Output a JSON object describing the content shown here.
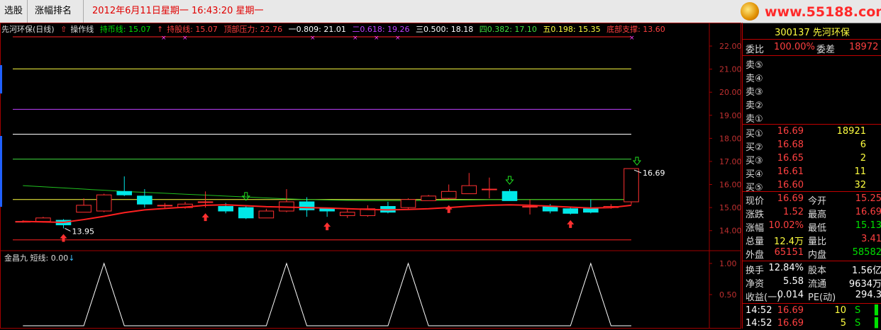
{
  "toolbar": {
    "tab_select": "选股",
    "tab_rank": "涨幅排名",
    "datetime": "2012年6月11日星期一  16:43:20 星期一",
    "logo": "www.55188.com"
  },
  "chart_legend": {
    "name": "先河环保(日线)",
    "op_line": "操作线",
    "hold_coin": "持币线: 15.07",
    "hold_stock": "持股线: 15.07",
    "top_pressure": "顶部压力: 22.76",
    "fib1": "一0.809: 21.01",
    "fib2": "二0.618: 19.26",
    "fib3": "三0.500: 18.18",
    "fib4": "四0.382: 17.10",
    "fib5": "五0.198: 15.35",
    "bottom_support": "底部支撑: 13.60",
    "colors": {
      "hold_coin": "#00e000",
      "hold_stock": "#ff4040",
      "fib2": "#c040ff",
      "fib4": "#40e040",
      "fib5": "#ffff40"
    }
  },
  "sub_indicator": {
    "name": "金昌九",
    "short_line": "短线: 0.00"
  },
  "quote": {
    "code": "300137",
    "name": "先河环保",
    "weibi_label": "委比",
    "weibi": "100.00%",
    "weicha_label": "委差",
    "weicha": "18972",
    "sell_labels": [
      "卖⑤",
      "卖④",
      "卖③",
      "卖②",
      "卖①"
    ],
    "buy": [
      {
        "label": "买①",
        "price": "16.69",
        "vol": "18921"
      },
      {
        "label": "买②",
        "price": "16.68",
        "vol": "6"
      },
      {
        "label": "买③",
        "price": "16.65",
        "vol": "2"
      },
      {
        "label": "买④",
        "price": "16.61",
        "vol": "11"
      },
      {
        "label": "买⑤",
        "price": "16.60",
        "vol": "32"
      }
    ],
    "stats": [
      {
        "l1": "现价",
        "v1": "16.69",
        "l2": "今开",
        "v2": "15.25",
        "c1": "#ff4040",
        "c2": "#ff4040"
      },
      {
        "l1": "涨跌",
        "v1": "1.52",
        "l2": "最高",
        "v2": "16.69",
        "c1": "#ff4040",
        "c2": "#ff4040"
      },
      {
        "l1": "涨幅",
        "v1": "10.02%",
        "l2": "最低",
        "v2": "15.13",
        "c1": "#ff4040",
        "c2": "#00e000"
      },
      {
        "l1": "总量",
        "v1": "12.4万",
        "l2": "量比",
        "v2": "3.41",
        "c1": "#ffff40",
        "c2": "#ff4040"
      },
      {
        "l1": "外盘",
        "v1": "65151",
        "l2": "内盘",
        "v2": "58582",
        "c1": "#ff4040",
        "c2": "#00e000"
      }
    ],
    "stats2": [
      {
        "l1": "换手",
        "v1": "12.84%",
        "l2": "股本",
        "v2": "1.56亿"
      },
      {
        "l1": "净资",
        "v1": "5.58",
        "l2": "流通",
        "v2": "9634万"
      },
      {
        "l1": "收益(一)",
        "v1": "0.014",
        "l2": "PE(动)",
        "v2": "294.3"
      }
    ],
    "ticks": [
      {
        "time": "14:52",
        "price": "16.69",
        "vol": "10",
        "side": "S"
      },
      {
        "time": "14:52",
        "price": "16.69",
        "vol": "5",
        "side": "S"
      }
    ]
  },
  "chart_data": {
    "type": "candlestick",
    "y_ticks": [
      "22.00",
      "21.00",
      "20.00",
      "19.00",
      "18.00",
      "17.00",
      "16.00",
      "15.00",
      "14.00"
    ],
    "sub_y_ticks": [
      "1.00",
      "0.50"
    ],
    "ylim": [
      13.5,
      22.4
    ],
    "levels": [
      {
        "value": 22.76,
        "color": "#ff2020"
      },
      {
        "value": 21.01,
        "color": "#ffff40"
      },
      {
        "value": 19.26,
        "color": "#c040ff"
      },
      {
        "value": 18.18,
        "color": "#ffffff"
      },
      {
        "value": 17.1,
        "color": "#40e040"
      },
      {
        "value": 15.35,
        "color": "#ffff40"
      },
      {
        "value": 13.6,
        "color": "#ff2020"
      }
    ],
    "candles": [
      [
        14.4,
        14.4,
        14.45,
        14.35
      ],
      [
        14.4,
        14.55,
        14.6,
        14.35
      ],
      [
        14.45,
        14.25,
        14.5,
        14.1
      ],
      [
        14.8,
        15.1,
        15.4,
        14.8
      ],
      [
        14.85,
        15.55,
        15.6,
        14.8
      ],
      [
        15.7,
        15.55,
        16.35,
        15.5
      ],
      [
        15.5,
        15.15,
        15.8,
        15.0
      ],
      [
        15.1,
        15.1,
        15.2,
        14.95
      ],
      [
        15.0,
        15.15,
        15.25,
        14.95
      ],
      [
        15.25,
        15.25,
        15.7,
        15.0
      ],
      [
        15.05,
        14.85,
        15.2,
        14.75
      ],
      [
        15.0,
        14.55,
        15.1,
        14.5
      ],
      [
        14.55,
        14.85,
        14.95,
        14.55
      ],
      [
        14.85,
        15.25,
        15.8,
        14.8
      ],
      [
        15.25,
        14.9,
        15.45,
        14.6
      ],
      [
        14.95,
        14.85,
        15.0,
        14.6
      ],
      [
        14.65,
        14.8,
        14.95,
        14.55
      ],
      [
        14.65,
        14.95,
        15.1,
        14.6
      ],
      [
        15.05,
        14.8,
        15.25,
        14.75
      ],
      [
        15.0,
        15.35,
        15.4,
        14.95
      ],
      [
        15.3,
        15.5,
        15.55,
        15.3
      ],
      [
        15.4,
        15.7,
        16.0,
        15.35
      ],
      [
        15.6,
        15.95,
        16.5,
        15.6
      ],
      [
        15.8,
        15.8,
        16.3,
        15.4
      ],
      [
        15.7,
        15.3,
        15.8,
        15.3
      ],
      [
        15.05,
        15.05,
        15.35,
        14.7
      ],
      [
        15.05,
        14.85,
        15.15,
        14.75
      ],
      [
        14.95,
        14.75,
        15.05,
        14.7
      ],
      [
        14.95,
        14.8,
        15.35,
        14.75
      ],
      [
        15.0,
        15.05,
        15.15,
        14.95
      ],
      [
        15.25,
        16.69,
        16.69,
        15.13
      ]
    ],
    "ma": [
      14.4,
      14.38,
      14.36,
      14.48,
      14.62,
      14.78,
      14.9,
      14.96,
      15.02,
      15.1,
      15.12,
      15.08,
      15.04,
      15.02,
      15.0,
      14.98,
      14.95,
      14.92,
      14.9,
      14.92,
      14.95,
      15.0,
      15.06,
      15.1,
      15.12,
      15.1,
      15.06,
      15.02,
      14.98,
      15.0,
      15.1
    ],
    "green_line": [
      15.95,
      15.9,
      15.85,
      15.8,
      15.75,
      15.7,
      15.66,
      15.62,
      15.58,
      15.54,
      15.5,
      15.46,
      15.42,
      15.38,
      15.35,
      15.33,
      15.31,
      15.3,
      15.3,
      15.3,
      15.31,
      15.32,
      15.33,
      15.34,
      15.35,
      15.35,
      15.35,
      15.35,
      15.35,
      15.35,
      15.35
    ],
    "buy_signals": [
      2,
      9,
      15,
      21,
      27
    ],
    "sell_signals": [
      11,
      24
    ],
    "annotations": [
      {
        "index": 2,
        "label": "13.95"
      },
      {
        "index": 30,
        "label": "16.69"
      }
    ],
    "sub_series": [
      0,
      0,
      0,
      0,
      1,
      0,
      0,
      0,
      0,
      0,
      0,
      0,
      0,
      1,
      0,
      0,
      0,
      0,
      0,
      1,
      0,
      0,
      0,
      0,
      0,
      0,
      0,
      0,
      1,
      0,
      0
    ]
  }
}
